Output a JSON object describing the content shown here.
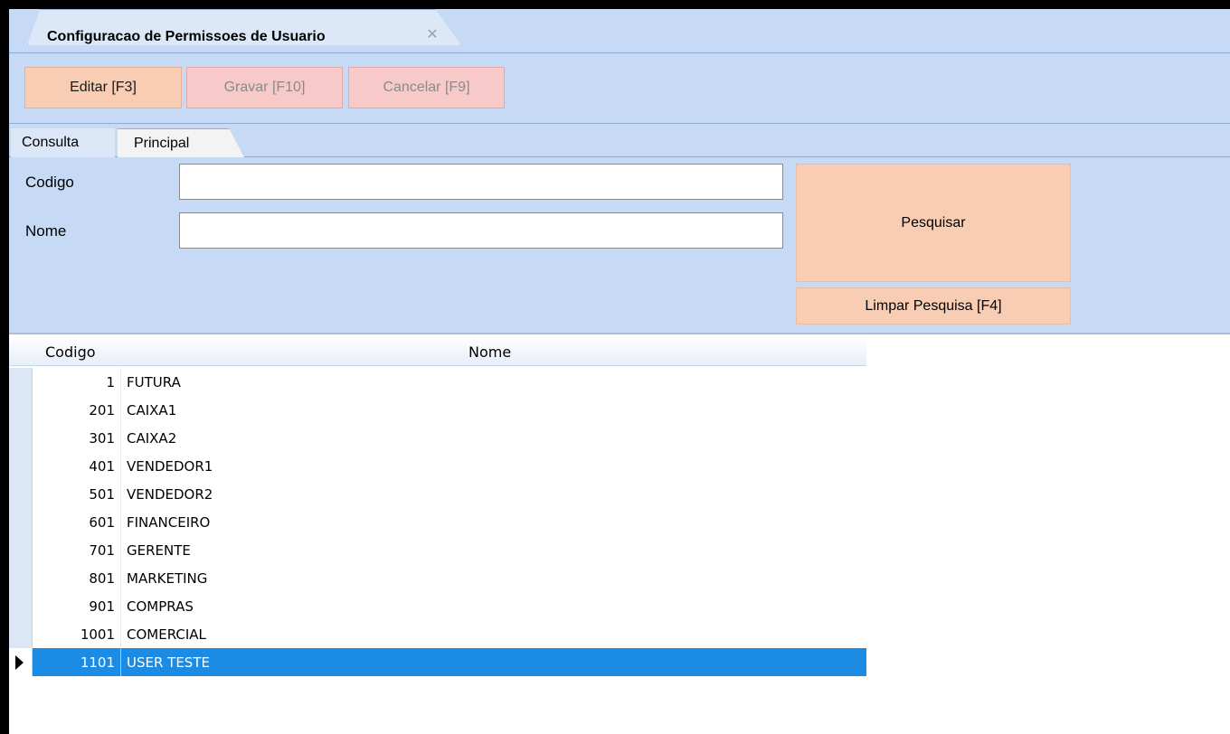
{
  "document_tab": {
    "title": "Configuracao de Permissoes de Usuario",
    "close_glyph": "✕"
  },
  "toolbar": {
    "edit_label": "Editar [F3]",
    "save_label": "Gravar [F10]",
    "cancel_label": "Cancelar [F9]"
  },
  "subtabs": {
    "consulta": "Consulta",
    "principal": "Principal"
  },
  "filters": {
    "codigo_label": "Codigo",
    "codigo_value": "",
    "nome_label": "Nome",
    "nome_value": "",
    "search_label": "Pesquisar",
    "clear_label": "Limpar Pesquisa [F4]"
  },
  "grid": {
    "columns": {
      "codigo": "Codigo",
      "nome": "Nome"
    },
    "rows": [
      {
        "codigo": "1",
        "nome": "FUTURA"
      },
      {
        "codigo": "201",
        "nome": "CAIXA1"
      },
      {
        "codigo": "301",
        "nome": "CAIXA2"
      },
      {
        "codigo": "401",
        "nome": "VENDEDOR1"
      },
      {
        "codigo": "501",
        "nome": "VENDEDOR2"
      },
      {
        "codigo": "601",
        "nome": "FINANCEIRO"
      },
      {
        "codigo": "701",
        "nome": "GERENTE"
      },
      {
        "codigo": "801",
        "nome": "MARKETING"
      },
      {
        "codigo": "901",
        "nome": "COMPRAS"
      },
      {
        "codigo": "1001",
        "nome": "COMERCIAL"
      },
      {
        "codigo": "1101",
        "nome": "USER TESTE"
      }
    ],
    "selected_index": 10
  },
  "colors": {
    "panel_bg": "#c6daf5",
    "primary_button": "#f8cdb3",
    "disabled_button": "#f7c9c9",
    "selection": "#1c8be3"
  }
}
